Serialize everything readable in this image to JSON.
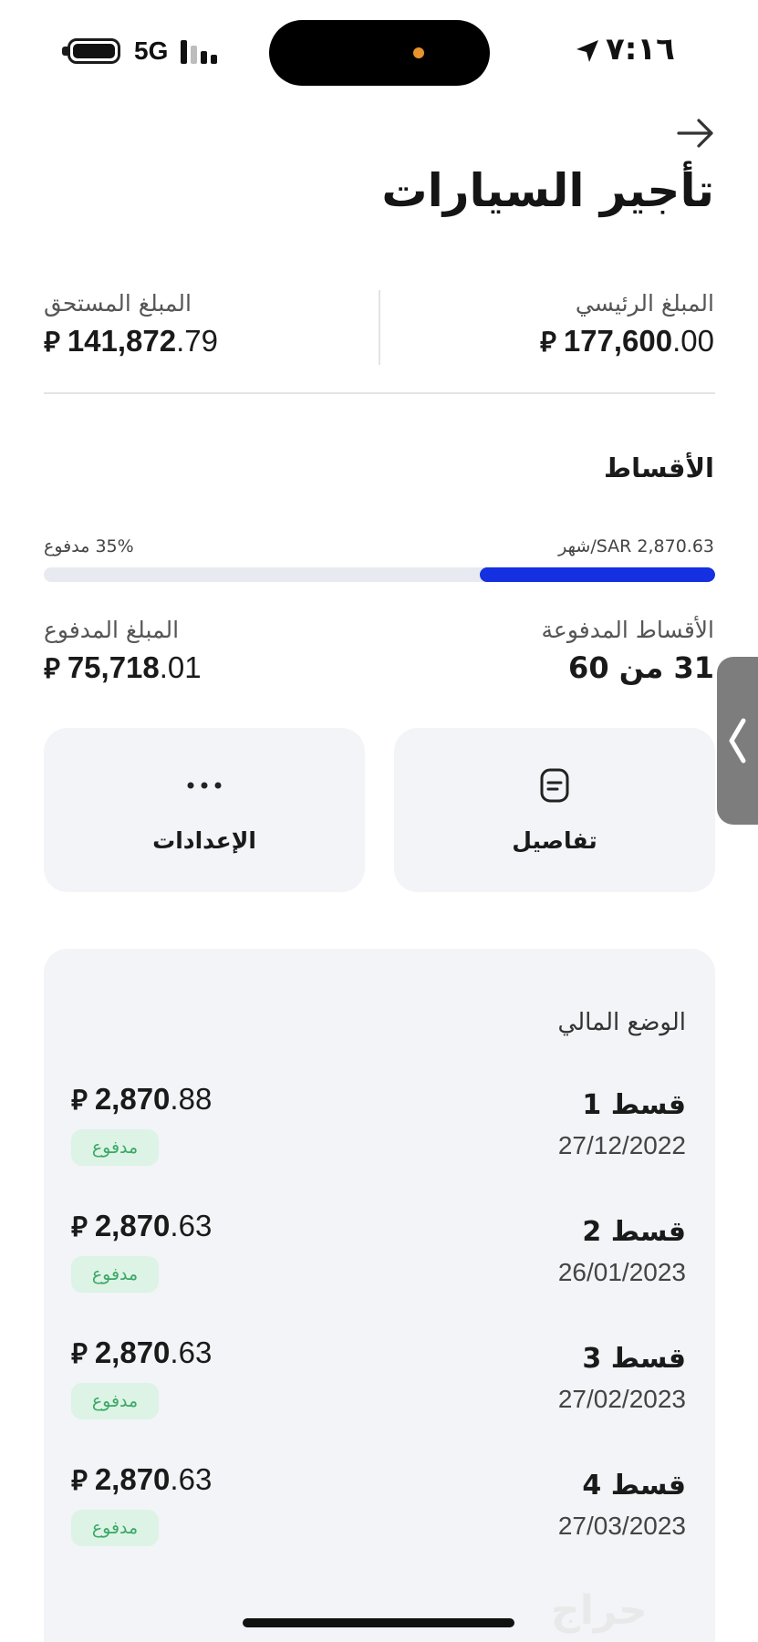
{
  "status_bar": {
    "time": "٧:١٦",
    "network": "5G"
  },
  "header": {
    "title": "تأجير السيارات"
  },
  "summary": {
    "principal_label": "المبلغ الرئيسي",
    "principal_int": "177,600",
    "principal_dec": ".00",
    "due_label": "المبلغ المستحق",
    "due_int": "141,872",
    "due_dec": ".79",
    "currency_symbol": "⃁"
  },
  "installments_section": {
    "title": "الأقساط",
    "monthly_text": "SAR 2,870.63/شهر",
    "paid_percent_text": "35% مدفوع",
    "paid_fraction": 0.35,
    "paid_installments_label": "الأقساط المدفوعة",
    "paid_installments_value": "31 من 60",
    "paid_amount_label": "المبلغ المدفوع",
    "paid_amount_int": "75,718",
    "paid_amount_dec": ".01"
  },
  "actions": {
    "details_label": "تفاصيل",
    "settings_label": "الإعدادات"
  },
  "financial_status": {
    "title": "الوضع المالي",
    "items": [
      {
        "name": "قسط 1",
        "date": "27/12/2022",
        "amount_int": "2,870",
        "amount_dec": ".88",
        "status": "مدفوع"
      },
      {
        "name": "قسط 2",
        "date": "26/01/2023",
        "amount_int": "2,870",
        "amount_dec": ".63",
        "status": "مدفوع"
      },
      {
        "name": "قسط 3",
        "date": "27/02/2023",
        "amount_int": "2,870",
        "amount_dec": ".63",
        "status": "مدفوع"
      },
      {
        "name": "قسط 4",
        "date": "27/03/2023",
        "amount_int": "2,870",
        "amount_dec": ".63",
        "status": "مدفوع"
      }
    ]
  },
  "watermark": "حراج",
  "colors": {
    "accent_blue": "#1430e0",
    "paid_badge_bg": "#dcf3e5",
    "paid_badge_text": "#3aa866",
    "card_bg": "#f2f4f7"
  },
  "icons": [
    "battery-icon",
    "signal-icon",
    "location-arrow-icon",
    "back-arrow-icon",
    "document-icon",
    "more-dots-icon",
    "chevron-left-icon"
  ]
}
